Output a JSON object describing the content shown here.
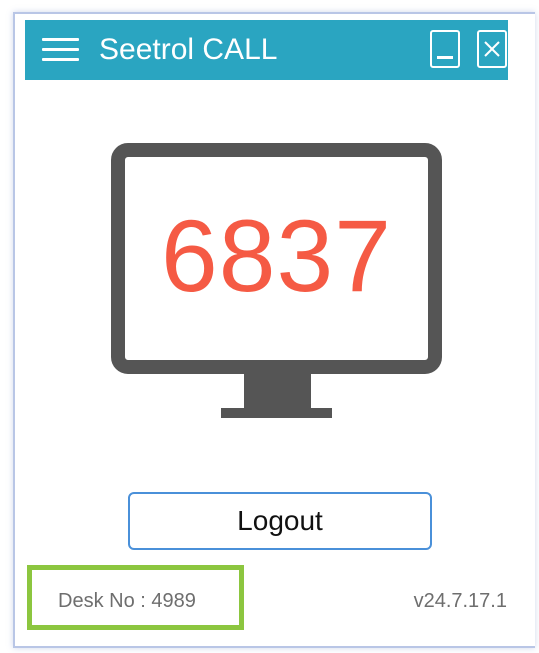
{
  "app": {
    "title": "Seetrol CALL",
    "brand_color": "#2aa5c1"
  },
  "icons": {
    "menu": "hamburger-menu-icon",
    "minimize": "minimize-icon",
    "close": "close-icon",
    "monitor": "monitor-icon"
  },
  "display": {
    "code": "6837",
    "code_color": "#f55a44",
    "monitor_color": "#555555"
  },
  "actions": {
    "logout_label": "Logout"
  },
  "footer": {
    "desk_label": "Desk No : 4989",
    "version": "v24.7.17.1",
    "highlight_color": "#8cc63f"
  }
}
